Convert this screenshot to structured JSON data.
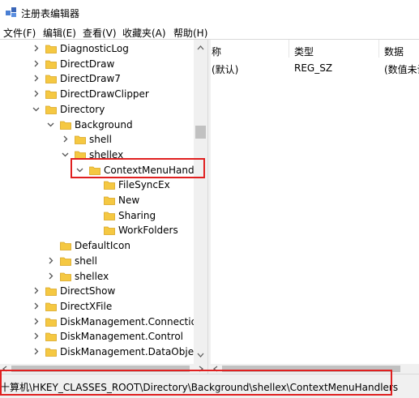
{
  "window": {
    "title": "注册表编辑器"
  },
  "menu": [
    "文件(F)",
    "编辑(E)",
    "查看(V)",
    "收藏夹(A)",
    "帮助(H)"
  ],
  "tree": [
    {
      "label": "DiagnosticLog",
      "level": 1,
      "expander": "collapsed",
      "selected": false
    },
    {
      "label": "DirectDraw",
      "level": 1,
      "expander": "collapsed",
      "selected": false
    },
    {
      "label": "DirectDraw7",
      "level": 1,
      "expander": "collapsed",
      "selected": false
    },
    {
      "label": "DirectDrawClipper",
      "level": 1,
      "expander": "collapsed",
      "selected": false
    },
    {
      "label": "Directory",
      "level": 1,
      "expander": "expanded",
      "selected": false
    },
    {
      "label": "Background",
      "level": 2,
      "expander": "expanded",
      "selected": false
    },
    {
      "label": "shell",
      "level": 3,
      "expander": "collapsed",
      "selected": false
    },
    {
      "label": "shellex",
      "level": 3,
      "expander": "expanded",
      "selected": false
    },
    {
      "label": "ContextMenuHandle",
      "level": 4,
      "expander": "expanded",
      "selected": true
    },
    {
      "label": "FileSyncEx",
      "level": 5,
      "expander": "none",
      "selected": false
    },
    {
      "label": "New",
      "level": 5,
      "expander": "none",
      "selected": false
    },
    {
      "label": "Sharing",
      "level": 5,
      "expander": "none",
      "selected": false
    },
    {
      "label": "WorkFolders",
      "level": 5,
      "expander": "none",
      "selected": false
    },
    {
      "label": "DefaultIcon",
      "level": 2,
      "expander": "none",
      "selected": false
    },
    {
      "label": "shell",
      "level": 2,
      "expander": "collapsed",
      "selected": false
    },
    {
      "label": "shellex",
      "level": 2,
      "expander": "collapsed",
      "selected": false
    },
    {
      "label": "DirectShow",
      "level": 1,
      "expander": "collapsed",
      "selected": false
    },
    {
      "label": "DirectXFile",
      "level": 1,
      "expander": "collapsed",
      "selected": false
    },
    {
      "label": "DiskManagement.Connection",
      "level": 1,
      "expander": "collapsed",
      "selected": false
    },
    {
      "label": "DiskManagement.Control",
      "level": 1,
      "expander": "collapsed",
      "selected": false
    },
    {
      "label": "DiskManagement.DataObject",
      "level": 1,
      "expander": "collapsed",
      "selected": false
    }
  ],
  "values": {
    "columns": [
      "称",
      "类型",
      "数据"
    ],
    "rows": [
      {
        "name": "(默认)",
        "type": "REG_SZ",
        "data": "(数值未设"
      }
    ]
  },
  "status": {
    "path": "十算机\\HKEY_CLASSES_ROOT\\Directory\\Background\\shellex\\ContextMenuHandlers"
  },
  "colors": {
    "highlight": "#e02020",
    "folder": "#f5c842"
  }
}
